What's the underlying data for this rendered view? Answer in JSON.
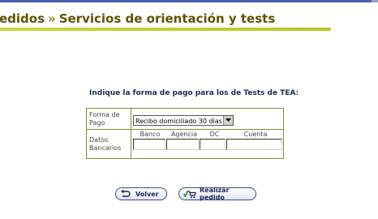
{
  "header": {
    "crumb_prev": "edidos",
    "separator": "»",
    "title": "Servicios de orientación y tests"
  },
  "prompt": "Indique la forma de pago para los de Tests de TEA:",
  "form": {
    "payment_label": "Forma de Pago",
    "payment_selected": "Recibo domiciliado 30 días",
    "bank_label": "Datos Bancarios",
    "bank_columns": [
      "Banco",
      "Agencia",
      "DC",
      "Cuenta"
    ]
  },
  "buttons": {
    "back_label": "Volver",
    "submit_label": "Realizar pedido"
  },
  "colors": {
    "title": "#5c5400",
    "accent_line": "#c8d63a",
    "table_border": "#8a8a3a",
    "button_text": "#1a2a55"
  }
}
